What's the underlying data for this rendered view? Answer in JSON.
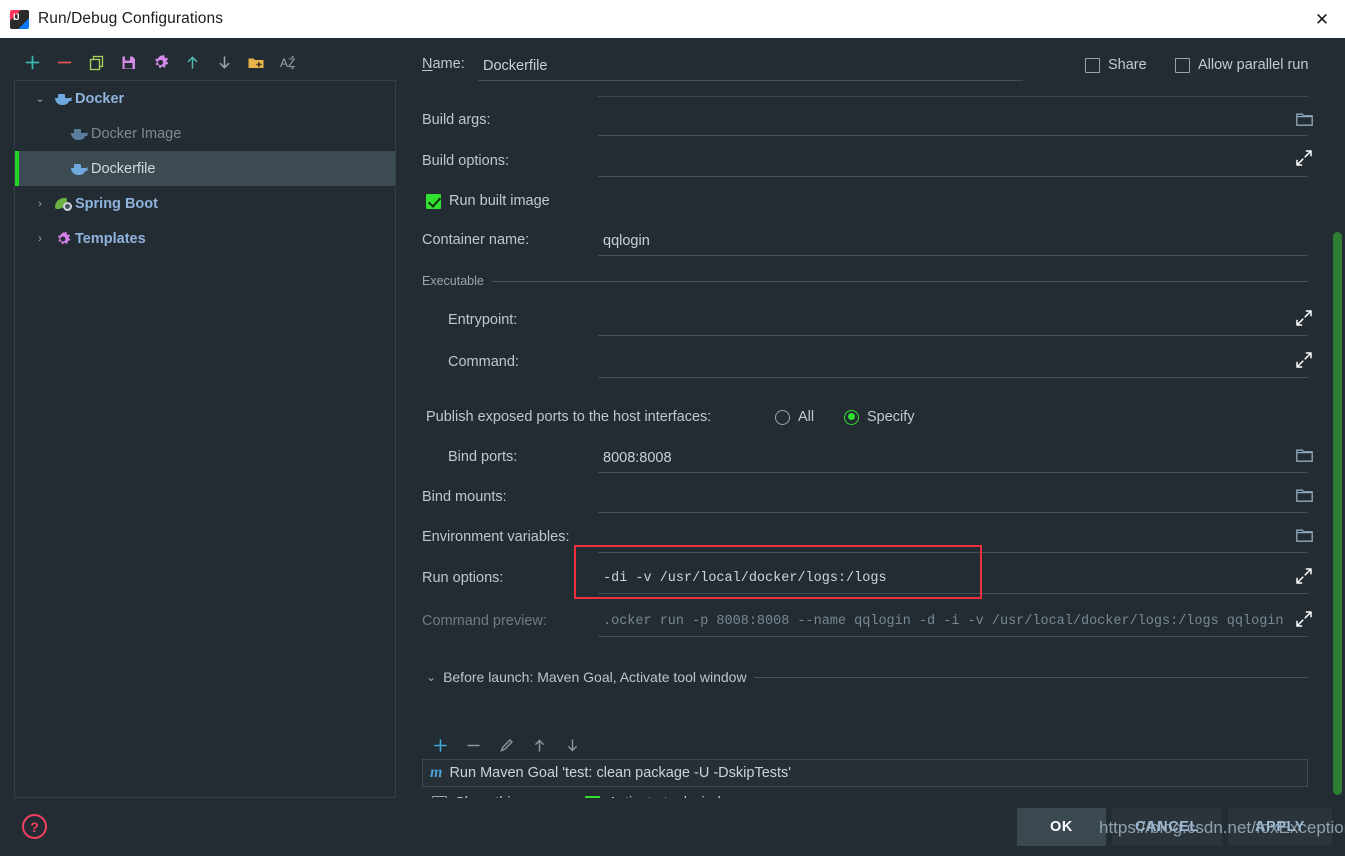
{
  "window": {
    "title": "Run/Debug Configurations",
    "close_label": "✕",
    "app_icon": "intellij-idea-logo"
  },
  "toolbar": {
    "items": [
      {
        "name": "add-configuration-button",
        "glyph": "+",
        "color": "#3ab5b0"
      },
      {
        "name": "remove-configuration-button",
        "glyph": "−",
        "color": "#e0554f"
      },
      {
        "name": "copy-configuration-button",
        "glyph": "copy-icon",
        "color": "#a8d45e"
      },
      {
        "name": "save-configuration-button",
        "glyph": "save-icon",
        "color": "#d389e8"
      },
      {
        "name": "edit-templates-button",
        "glyph": "gear-icon",
        "color": "#d389e8"
      },
      {
        "name": "move-up-button",
        "glyph": "↑",
        "color": "#4fb8b0"
      },
      {
        "name": "move-down-button",
        "glyph": "↓",
        "color": "#9aa5ad"
      },
      {
        "name": "new-folder-button",
        "glyph": "folder-plus-icon",
        "color": "#e8b44a"
      },
      {
        "name": "sort-configurations-button",
        "glyph": "AZ",
        "color": "#9aa5ad"
      }
    ]
  },
  "tree": {
    "items": [
      {
        "label": "Docker",
        "icon": "docker-whale-icon",
        "level": 0,
        "expanded": true,
        "chevron": "⌄",
        "selected": false,
        "style": "bold"
      },
      {
        "label": "Docker Image",
        "icon": "docker-whale-icon",
        "level": 1,
        "expanded": null,
        "chevron": "",
        "selected": false,
        "style": "dim"
      },
      {
        "label": "Dockerfile",
        "icon": "docker-whale-icon",
        "level": 1,
        "expanded": null,
        "chevron": "",
        "selected": true,
        "style": "plain"
      },
      {
        "label": "Spring Boot",
        "icon": "spring-leaf-icon",
        "level": 0,
        "expanded": false,
        "chevron": "›",
        "selected": false,
        "style": "bold"
      },
      {
        "label": "Templates",
        "icon": "gear-icon",
        "level": 0,
        "expanded": false,
        "chevron": "›",
        "selected": false,
        "style": "bold"
      }
    ]
  },
  "form": {
    "name_label": "Name:",
    "name_value": "Dockerfile",
    "share_label": "Share",
    "share_checked": false,
    "allow_parallel_label": "Allow parallel run",
    "allow_parallel_checked": false,
    "build_args_label": "Build args:",
    "build_args_value": "",
    "build_options_label": "Build options:",
    "build_options_value": "",
    "run_built_image_label": "Run built image",
    "run_built_image_checked": true,
    "container_name_label": "Container name:",
    "container_name_value": "qqlogin",
    "executable_section": "Executable",
    "entrypoint_label": "Entrypoint:",
    "entrypoint_value": "",
    "command_label": "Command:",
    "command_value": "",
    "publish_ports_label": "Publish exposed ports to the host interfaces:",
    "ports_option_all": "All",
    "ports_option_specify": "Specify",
    "ports_selected": "Specify",
    "bind_ports_label": "Bind ports:",
    "bind_ports_value": "8008:8008",
    "bind_mounts_label": "Bind mounts:",
    "bind_mounts_value": "",
    "env_vars_label": "Environment variables:",
    "env_vars_value": "",
    "run_options_label": "Run options:",
    "run_options_value": "-di -v /usr/local/docker/logs:/logs",
    "command_preview_label": "Command preview:",
    "command_preview_value": ".ocker run -p 8008:8008 --name qqlogin -d -i -v /usr/local/docker/logs:/logs qqlogin"
  },
  "before_launch": {
    "header": "Before launch: Maven Goal, Activate tool window",
    "chevron": "⌄",
    "toolbar": [
      {
        "name": "add-before-launch-task-button",
        "glyph": "+",
        "color": "#3ea8d8"
      },
      {
        "name": "remove-before-launch-task-button",
        "glyph": "−",
        "color": "#8b969e"
      },
      {
        "name": "edit-before-launch-task-button",
        "glyph": "pencil-icon",
        "color": "#8b969e"
      },
      {
        "name": "move-task-up-button",
        "glyph": "↑",
        "color": "#8b969e"
      },
      {
        "name": "move-task-down-button",
        "glyph": "↓",
        "color": "#8b969e"
      }
    ],
    "tasks": [
      {
        "icon": "maven-icon",
        "icon_glyph": "m",
        "label": "Run Maven Goal 'test: clean package -U -DskipTests'"
      }
    ],
    "show_this_page_label": "Show this page",
    "show_this_page_checked": false,
    "activate_tool_window_label": "Activate tool window",
    "activate_tool_window_checked": true
  },
  "footer": {
    "help_glyph": "?",
    "ok_label": "OK",
    "cancel_label": "CANCEL",
    "apply_label": "APPLY"
  },
  "watermark": "https://blog.csdn.net/foxException",
  "colors": {
    "background": "#242c33",
    "titlebar": "#ffffff",
    "selection": "#3c4b51",
    "selection_stripe": "#21d324",
    "accent_green": "#2fe02f",
    "scrollbar_green": "#2f7d33",
    "annotation_red": "#ef2f3c",
    "tree_node_blue": "#8fb3dd",
    "button_blue": "#9dbbd6"
  }
}
